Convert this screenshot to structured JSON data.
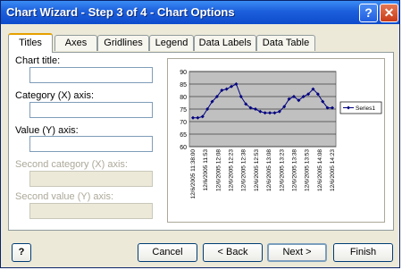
{
  "window": {
    "title": "Chart Wizard - Step 3 of 4 - Chart Options",
    "help_glyph": "?",
    "close_glyph": "✕"
  },
  "tabs": [
    {
      "label": "Titles"
    },
    {
      "label": "Axes"
    },
    {
      "label": "Gridlines"
    },
    {
      "label": "Legend"
    },
    {
      "label": "Data Labels"
    },
    {
      "label": "Data Table"
    }
  ],
  "fields": {
    "chart_title_label": "Chart title:",
    "chart_title_value": "",
    "category_x_label": "Category (X) axis:",
    "category_x_value": "",
    "value_y_label": "Value (Y) axis:",
    "value_y_value": "",
    "second_category_label": "Second category (X) axis:",
    "second_value_label": "Second value (Y) axis:"
  },
  "chart_data": {
    "type": "line",
    "ylim": [
      60,
      90
    ],
    "yticks": [
      "60",
      "65",
      "70",
      "75",
      "80",
      "85",
      "90"
    ],
    "x_tick_labels": [
      "12/6/2005 11:38:00",
      "12/6/2005 11:53",
      "12/6/2005 12:08",
      "12/6/2005 12:23",
      "12/6/2005 12:38",
      "12/6/2005 12:53",
      "12/6/2005 13:08",
      "12/6/2005 13:23",
      "12/6/2005 13:38",
      "12/6/2005 13:53",
      "12/6/2005 14:08",
      "12/6/2005 14:23"
    ],
    "series": [
      {
        "name": "Series1",
        "values": [
          71.5,
          71.5,
          72,
          75,
          78,
          80,
          82.5,
          83,
          84,
          85,
          80,
          77,
          75.5,
          75,
          74,
          73.5,
          73.5,
          73.5,
          74,
          76,
          79,
          80,
          78.5,
          80,
          81,
          83,
          81,
          78,
          75.5,
          75.5
        ]
      }
    ],
    "legend_position": "right",
    "plot_background": "#c0c0c0",
    "series_color": "#000080"
  },
  "buttons": {
    "help": "?",
    "cancel": "Cancel",
    "back": "< Back",
    "next": "Next >",
    "finish": "Finish"
  }
}
